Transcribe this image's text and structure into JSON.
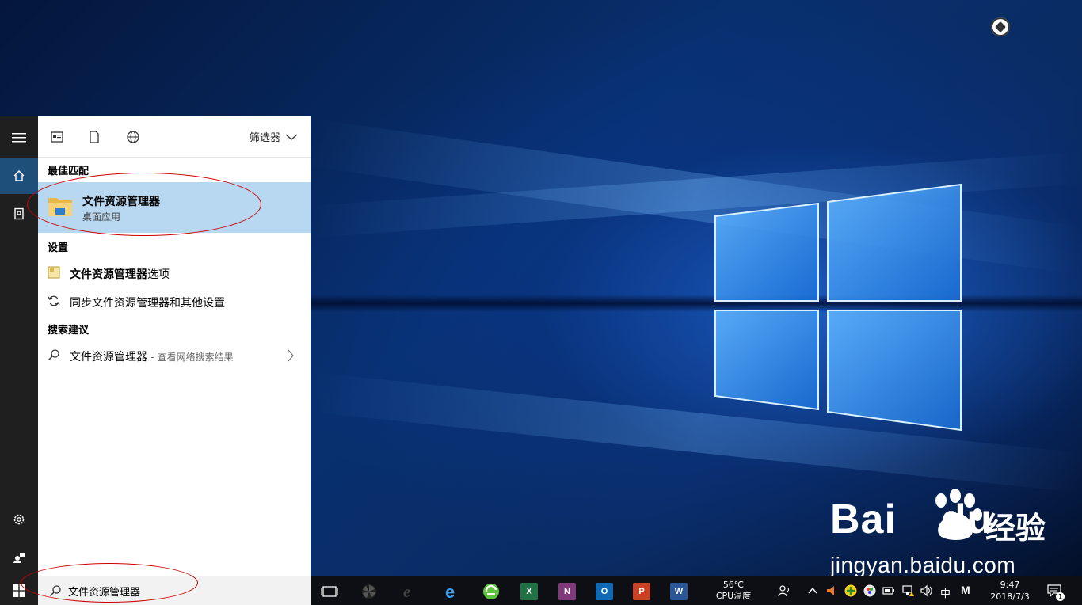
{
  "search_panel": {
    "filter_label": "筛选器",
    "best_match_header": "最佳匹配",
    "best_match": {
      "title": "文件资源管理器",
      "subtitle": "桌面应用"
    },
    "settings_header": "设置",
    "settings_items": [
      {
        "label_bold": "文件资源管理器",
        "label_rest": "选项"
      },
      {
        "label": "同步文件资源管理器和其他设置"
      }
    ],
    "suggestions_header": "搜索建议",
    "suggestion": {
      "label": "文件资源管理器",
      "hint": "- 查看网络搜索结果"
    }
  },
  "search_box": {
    "value": "文件资源管理器"
  },
  "taskbar": {
    "cpu_temp": "56℃",
    "cpu_label": "CPU温度",
    "ime": "中",
    "ime_mode": "M",
    "time": "9:47",
    "date": "2018/7/3",
    "notification_count": "1",
    "app_letters": {
      "excel": "X",
      "onenote": "N",
      "outlook": "O",
      "powerpoint": "P",
      "word": "W"
    }
  },
  "watermark": {
    "brand": "Bai",
    "brand_du": "du",
    "cn": "经验",
    "url": "jingyan.baidu.com"
  },
  "colors": {
    "accent": "#1e4f7a",
    "selection": "#b8d7f0",
    "rail": "#1f1f1f",
    "taskbar": "#0d0f14"
  }
}
